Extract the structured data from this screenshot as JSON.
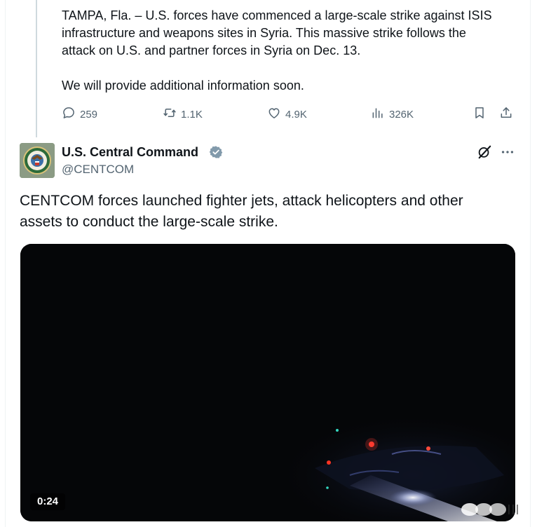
{
  "tweet1": {
    "body_lines": [
      "TAMPA, Fla. – U.S. forces have commenced a large-scale strike against ISIS",
      "infrastructure and weapons sites in Syria. This massive strike follows the",
      "attack on U.S. and partner forces in Syria on Dec. 13."
    ],
    "body_followup": "We will provide additional information soon.",
    "actions": {
      "replies": "259",
      "reposts": "1.1K",
      "likes": "4.9K",
      "views": "326K"
    }
  },
  "tweet2": {
    "author_name": "U.S. Central Command",
    "author_handle": "@CENTCOM",
    "verified": true,
    "body_lines": [
      "CENTCOM forces launched fighter jets, attack helicopters and other",
      "assets to conduct the large-scale strike."
    ],
    "video": {
      "duration": "0:24"
    }
  },
  "icons": {
    "reply": "reply-icon",
    "repost": "repost-icon",
    "like": "like-icon",
    "views": "views-icon",
    "bookmark": "bookmark-icon",
    "share": "share-icon",
    "grok": "grok-icon",
    "more": "more-icon",
    "verified": "verified-badge-icon"
  },
  "colors": {
    "text_primary": "#0f1419",
    "text_secondary": "#536471",
    "verified_badge": "#829aab",
    "video_background": "#050608"
  }
}
